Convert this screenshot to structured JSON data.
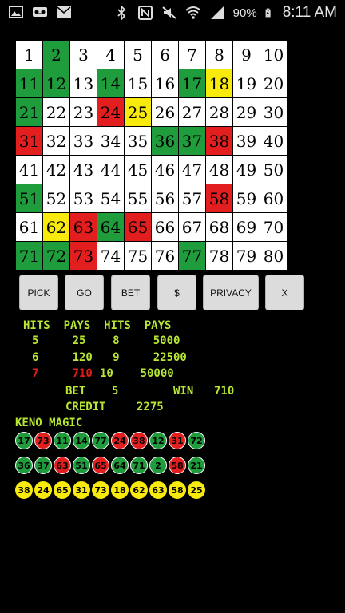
{
  "status_bar": {
    "battery": "90%",
    "time": "8:11 AM",
    "left_icons": [
      "image-icon",
      "voicemail-icon",
      "mail-icon"
    ],
    "right_icons": [
      "bluetooth-icon",
      "nfc-icon",
      "mute-icon",
      "wifi-icon",
      "signal-icon",
      "battery-icon"
    ]
  },
  "grid": {
    "cells": [
      {
        "n": "1",
        "c": "white"
      },
      {
        "n": "2",
        "c": "green"
      },
      {
        "n": "3",
        "c": "white"
      },
      {
        "n": "4",
        "c": "white"
      },
      {
        "n": "5",
        "c": "white"
      },
      {
        "n": "6",
        "c": "white"
      },
      {
        "n": "7",
        "c": "white"
      },
      {
        "n": "8",
        "c": "white"
      },
      {
        "n": "9",
        "c": "white"
      },
      {
        "n": "10",
        "c": "white"
      },
      {
        "n": "11",
        "c": "green"
      },
      {
        "n": "12",
        "c": "green"
      },
      {
        "n": "13",
        "c": "white"
      },
      {
        "n": "14",
        "c": "green"
      },
      {
        "n": "15",
        "c": "white"
      },
      {
        "n": "16",
        "c": "white"
      },
      {
        "n": "17",
        "c": "green"
      },
      {
        "n": "18",
        "c": "yellow"
      },
      {
        "n": "19",
        "c": "white"
      },
      {
        "n": "20",
        "c": "white"
      },
      {
        "n": "21",
        "c": "green"
      },
      {
        "n": "22",
        "c": "white"
      },
      {
        "n": "23",
        "c": "white"
      },
      {
        "n": "24",
        "c": "red"
      },
      {
        "n": "25",
        "c": "yellow"
      },
      {
        "n": "26",
        "c": "white"
      },
      {
        "n": "27",
        "c": "white"
      },
      {
        "n": "28",
        "c": "white"
      },
      {
        "n": "29",
        "c": "white"
      },
      {
        "n": "30",
        "c": "white"
      },
      {
        "n": "31",
        "c": "red"
      },
      {
        "n": "32",
        "c": "white"
      },
      {
        "n": "33",
        "c": "white"
      },
      {
        "n": "34",
        "c": "white"
      },
      {
        "n": "35",
        "c": "white"
      },
      {
        "n": "36",
        "c": "green"
      },
      {
        "n": "37",
        "c": "green"
      },
      {
        "n": "38",
        "c": "red"
      },
      {
        "n": "39",
        "c": "white"
      },
      {
        "n": "40",
        "c": "white"
      },
      {
        "n": "41",
        "c": "white"
      },
      {
        "n": "42",
        "c": "white"
      },
      {
        "n": "43",
        "c": "white"
      },
      {
        "n": "44",
        "c": "white"
      },
      {
        "n": "45",
        "c": "white"
      },
      {
        "n": "46",
        "c": "white"
      },
      {
        "n": "47",
        "c": "white"
      },
      {
        "n": "48",
        "c": "white"
      },
      {
        "n": "49",
        "c": "white"
      },
      {
        "n": "50",
        "c": "white"
      },
      {
        "n": "51",
        "c": "green"
      },
      {
        "n": "52",
        "c": "white"
      },
      {
        "n": "53",
        "c": "white"
      },
      {
        "n": "54",
        "c": "white"
      },
      {
        "n": "55",
        "c": "white"
      },
      {
        "n": "56",
        "c": "white"
      },
      {
        "n": "57",
        "c": "white"
      },
      {
        "n": "58",
        "c": "red"
      },
      {
        "n": "59",
        "c": "white"
      },
      {
        "n": "60",
        "c": "white"
      },
      {
        "n": "61",
        "c": "white"
      },
      {
        "n": "62",
        "c": "yellow"
      },
      {
        "n": "63",
        "c": "red"
      },
      {
        "n": "64",
        "c": "green"
      },
      {
        "n": "65",
        "c": "red"
      },
      {
        "n": "66",
        "c": "white"
      },
      {
        "n": "67",
        "c": "white"
      },
      {
        "n": "68",
        "c": "white"
      },
      {
        "n": "69",
        "c": "white"
      },
      {
        "n": "70",
        "c": "white"
      },
      {
        "n": "71",
        "c": "green"
      },
      {
        "n": "72",
        "c": "green"
      },
      {
        "n": "73",
        "c": "red"
      },
      {
        "n": "74",
        "c": "white"
      },
      {
        "n": "75",
        "c": "white"
      },
      {
        "n": "76",
        "c": "white"
      },
      {
        "n": "77",
        "c": "green"
      },
      {
        "n": "78",
        "c": "white"
      },
      {
        "n": "79",
        "c": "white"
      },
      {
        "n": "80",
        "c": "white"
      }
    ]
  },
  "buttons": {
    "pick": "PICK",
    "go": "GO",
    "bet": "BET",
    "dollar": "$",
    "privacy": "PRIVACY",
    "close": "X"
  },
  "paytable": {
    "header": "HITS  PAYS  HITS  PAYS",
    "row1": "5     25    8     5000",
    "row2": "6     120   9     22500",
    "row3_left": "7     710",
    "row3_right": "10    50000"
  },
  "stats": {
    "bet_label": "BET",
    "bet_value": "5",
    "win_label": "WIN",
    "win_value": "710",
    "credit_label": "CREDIT",
    "credit_value": "2275"
  },
  "magic": {
    "title": "KENO MAGIC",
    "rows": [
      [
        {
          "n": "17",
          "c": "green"
        },
        {
          "n": "73",
          "c": "red"
        },
        {
          "n": "11",
          "c": "green"
        },
        {
          "n": "14",
          "c": "green"
        },
        {
          "n": "77",
          "c": "green"
        },
        {
          "n": "24",
          "c": "red"
        },
        {
          "n": "38",
          "c": "red"
        },
        {
          "n": "12",
          "c": "green"
        },
        {
          "n": "31",
          "c": "red"
        },
        {
          "n": "72",
          "c": "green"
        }
      ],
      [
        {
          "n": "36",
          "c": "green"
        },
        {
          "n": "37",
          "c": "green"
        },
        {
          "n": "63",
          "c": "red"
        },
        {
          "n": "51",
          "c": "green"
        },
        {
          "n": "65",
          "c": "red"
        },
        {
          "n": "64",
          "c": "green"
        },
        {
          "n": "71",
          "c": "green"
        },
        {
          "n": "2",
          "c": "green"
        },
        {
          "n": "58",
          "c": "red"
        },
        {
          "n": "21",
          "c": "green"
        }
      ],
      [
        {
          "n": "38",
          "c": "yellow"
        },
        {
          "n": "24",
          "c": "yellow"
        },
        {
          "n": "65",
          "c": "yellow"
        },
        {
          "n": "31",
          "c": "yellow"
        },
        {
          "n": "73",
          "c": "yellow"
        },
        {
          "n": "18",
          "c": "yellow"
        },
        {
          "n": "62",
          "c": "yellow"
        },
        {
          "n": "63",
          "c": "yellow"
        },
        {
          "n": "58",
          "c": "yellow"
        },
        {
          "n": "25",
          "c": "yellow"
        }
      ]
    ]
  },
  "colors": {
    "green": "#1f9c3b",
    "red": "#e21e1e",
    "yellow": "#f7ea0c",
    "text_accent": "#b8e635"
  }
}
